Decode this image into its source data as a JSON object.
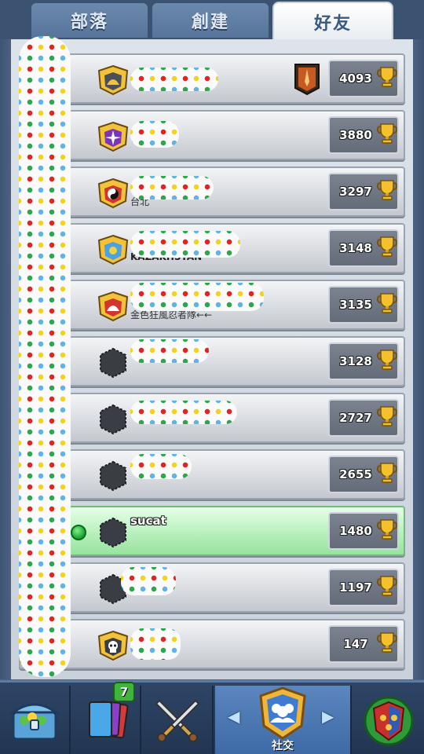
{
  "tabs": [
    {
      "label": "部落",
      "active": false
    },
    {
      "label": "創建",
      "active": false
    },
    {
      "label": "好友",
      "active": true
    }
  ],
  "rows": [
    {
      "name": "",
      "clan": "",
      "trophies": "4093",
      "badge": "fan-badge",
      "arena": true,
      "online": false,
      "self": false
    },
    {
      "name": "",
      "clan": "",
      "trophies": "3880",
      "badge": "star-badge",
      "arena": false,
      "online": false,
      "self": false
    },
    {
      "name": "",
      "clan": "台北",
      "trophies": "3297",
      "badge": "yinyang-badge",
      "arena": false,
      "online": false,
      "self": false
    },
    {
      "name": "",
      "clan": "KAZAKHSTAN",
      "trophies": "3148",
      "badge": "shield-badge",
      "arena": false,
      "online": false,
      "self": false
    },
    {
      "name": "",
      "clan": "金色狂風忍者隊←←",
      "trophies": "3135",
      "badge": "fan-red-badge",
      "arena": false,
      "online": false,
      "self": false
    },
    {
      "name": "",
      "clan": "",
      "trophies": "3128",
      "badge": "no-clan-badge",
      "arena": false,
      "online": false,
      "self": false
    },
    {
      "name": "",
      "clan": "",
      "trophies": "2727",
      "badge": "no-clan-badge",
      "arena": false,
      "online": false,
      "self": false
    },
    {
      "name": "",
      "clan": "",
      "trophies": "2655",
      "badge": "no-clan-badge",
      "arena": false,
      "online": false,
      "self": false
    },
    {
      "name": "sucat",
      "clan": "",
      "trophies": "1480",
      "badge": "no-clan-badge",
      "arena": false,
      "online": true,
      "self": true
    },
    {
      "name": "",
      "clan": "",
      "trophies": "1197",
      "badge": "no-clan-badge",
      "arena": false,
      "online": false,
      "self": false
    },
    {
      "name": "",
      "clan": "",
      "trophies": "147",
      "badge": "skull-badge",
      "arena": false,
      "online": false,
      "self": false
    }
  ],
  "nav": {
    "items": [
      {
        "icon": "chest-icon"
      },
      {
        "icon": "cards-icon",
        "badge": "7"
      },
      {
        "icon": "swords-icon"
      },
      {
        "icon": "social-icon",
        "label": "社交",
        "active": true
      },
      {
        "icon": "tournament-icon"
      }
    ]
  },
  "colors": {
    "tab_active_text": "#3b5a80",
    "self_row": "#b8f0bc",
    "trophy_box": "#6f7784"
  }
}
